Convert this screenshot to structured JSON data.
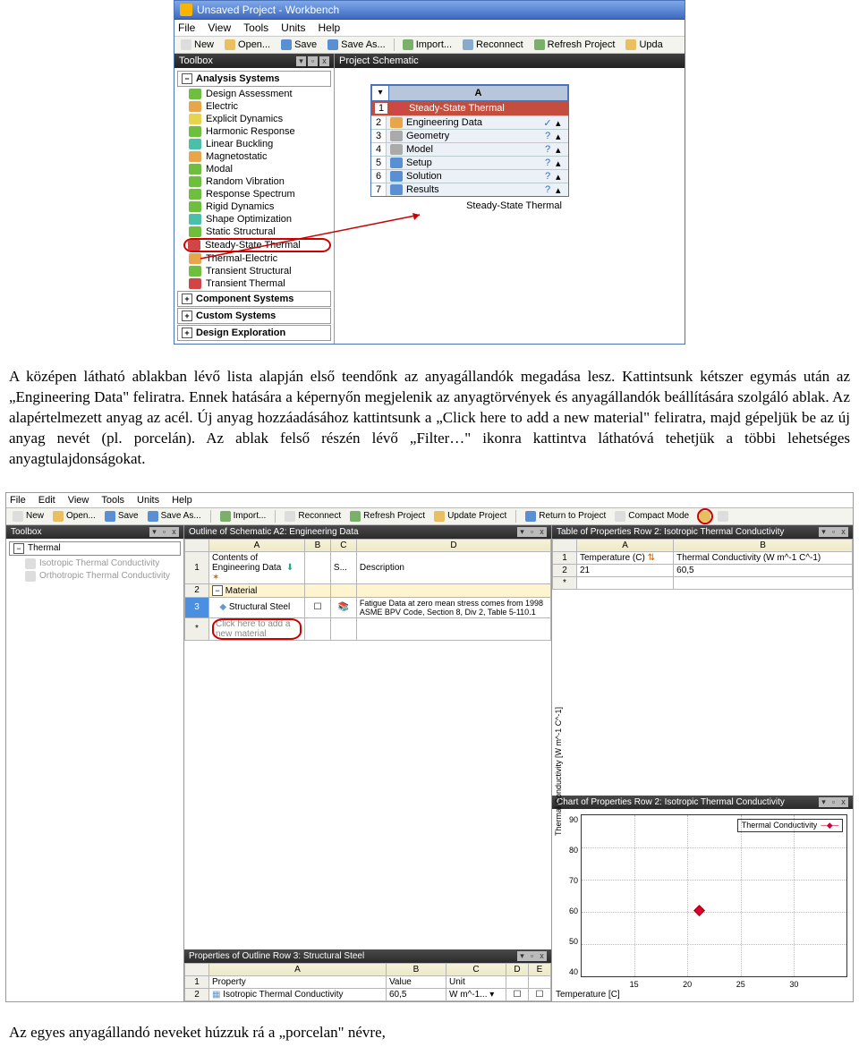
{
  "shot1": {
    "title": "Unsaved Project - Workbench",
    "menu": [
      "File",
      "View",
      "Tools",
      "Units",
      "Help"
    ],
    "toolbar": [
      {
        "icon": "new",
        "label": "New"
      },
      {
        "icon": "open",
        "label": "Open..."
      },
      {
        "icon": "save",
        "label": "Save"
      },
      {
        "icon": "saveas",
        "label": "Save As..."
      },
      {
        "icon": "import",
        "label": "Import..."
      },
      {
        "icon": "reconnect",
        "label": "Reconnect"
      },
      {
        "icon": "refresh",
        "label": "Refresh Project"
      },
      {
        "icon": "upda",
        "label": "Upda"
      }
    ],
    "toolbox_title": "Toolbox",
    "analysis_header": "Analysis Systems",
    "analysis_items": [
      {
        "c": "c-green",
        "t": "Design Assessment"
      },
      {
        "c": "c-orange",
        "t": "Electric"
      },
      {
        "c": "c-yellow",
        "t": "Explicit Dynamics"
      },
      {
        "c": "c-green",
        "t": "Harmonic Response"
      },
      {
        "c": "c-teal",
        "t": "Linear Buckling"
      },
      {
        "c": "c-orange",
        "t": "Magnetostatic"
      },
      {
        "c": "c-green",
        "t": "Modal"
      },
      {
        "c": "c-green",
        "t": "Random Vibration"
      },
      {
        "c": "c-green",
        "t": "Response Spectrum"
      },
      {
        "c": "c-green",
        "t": "Rigid Dynamics"
      },
      {
        "c": "c-teal",
        "t": "Shape Optimization"
      },
      {
        "c": "c-green",
        "t": "Static Structural"
      },
      {
        "c": "c-red",
        "t": "Steady-State Thermal",
        "hl": true
      },
      {
        "c": "c-orange",
        "t": "Thermal-Electric"
      },
      {
        "c": "c-green",
        "t": "Transient Structural"
      },
      {
        "c": "c-red",
        "t": "Transient Thermal"
      }
    ],
    "other_groups": [
      "Component Systems",
      "Custom Systems",
      "Design Exploration"
    ],
    "schematic_title": "Project Schematic",
    "sys": {
      "colA": "A",
      "title": "Steady-State Thermal",
      "rows": [
        {
          "n": "2",
          "ic": "c-orange",
          "t": "Engineering Data",
          "s": "✓"
        },
        {
          "n": "3",
          "ic": "c-gray",
          "t": "Geometry",
          "s": "?"
        },
        {
          "n": "4",
          "ic": "c-gray",
          "t": "Model",
          "s": "?"
        },
        {
          "n": "5",
          "ic": "c-blue",
          "t": "Setup",
          "s": "?"
        },
        {
          "n": "6",
          "ic": "c-blue",
          "t": "Solution",
          "s": "?"
        },
        {
          "n": "7",
          "ic": "c-blue",
          "t": "Results",
          "s": "?"
        }
      ],
      "caption": "Steady-State Thermal"
    }
  },
  "para1": "A középen látható ablakban lévő lista alapján első teendőnk az anyagállandók megadása lesz. Kattintsunk kétszer egymás után az „Engineering Data\" feliratra. Ennek hatására a képernyőn megjelenik az anyagtörvények és anyagállandók beállítására szolgáló ablak. Az alapértelmezett anyag az acél. Új anyag hozzáadásához kattintsunk a „Click here to add a new material\" feliratra, majd gépeljük be az új anyag nevét (pl. porcelán). Az ablak felső részén lévő „Filter…\" ikonra kattintva láthatóvá tehetjük a többi lehetséges anyagtulajdonságokat.",
  "shot2": {
    "menu": [
      "File",
      "Edit",
      "View",
      "Tools",
      "Units",
      "Help"
    ],
    "toolbar": [
      "New",
      "Open...",
      "Save",
      "Save As...",
      "Import...",
      "Reconnect",
      "Refresh Project",
      "Update Project",
      "Return to Project",
      "Compact Mode"
    ],
    "left": {
      "title": "Toolbox",
      "group": "Thermal",
      "items": [
        "Isotropic Thermal Conductivity",
        "Orthotropic Thermal Conductivity"
      ]
    },
    "outline": {
      "title": "Outline of Schematic A2: Engineering Data",
      "cols": [
        "",
        "A",
        "B",
        "C",
        "D"
      ],
      "r1": [
        "1",
        "Contents of Engineering Data",
        "",
        "S...",
        "Description"
      ],
      "r2": [
        "2",
        "Material",
        "",
        "",
        ""
      ],
      "r3": [
        "3",
        "Structural Steel",
        "",
        "",
        "Fatigue Data at zero mean stress comes from 1998 ASME BPV Code, Section 8, Div 2, Table 5-110.1"
      ],
      "r4": [
        "*",
        "Click here to add a new material",
        "",
        "",
        ""
      ]
    },
    "table": {
      "title": "Table of Properties Row 2: Isotropic Thermal Conductivity",
      "cols": [
        "",
        "A",
        "B"
      ],
      "r1": [
        "1",
        "Temperature (C)",
        "Thermal Conductivity (W m^-1 C^-1)"
      ],
      "r2": [
        "2",
        "21",
        "60,5"
      ],
      "r3": [
        "*",
        "",
        ""
      ]
    },
    "props": {
      "title": "Properties of Outline Row 3: Structural Steel",
      "cols": [
        "",
        "A",
        "B",
        "C",
        "D",
        "E"
      ],
      "r1": [
        "1",
        "Property",
        "Value",
        "Unit",
        "",
        ""
      ],
      "r2": [
        "2",
        "Isotropic Thermal Conductivity",
        "60,5",
        "W m^-1...",
        "",
        ""
      ]
    },
    "chart": {
      "title": "Chart of Properties Row 2: Isotropic Thermal Conductivity"
    }
  },
  "chart_data": {
    "type": "scatter",
    "series": [
      {
        "name": "Thermal Conductivity",
        "x": [
          21
        ],
        "y": [
          60.5
        ]
      }
    ],
    "xlabel": "Temperature [C]",
    "ylabel": "Thermal Conductivity [W m^-1 C^-1]",
    "xlim": [
      10,
      35
    ],
    "ylim": [
      40,
      90
    ],
    "xticks": [
      15,
      20,
      25,
      30
    ],
    "yticks": [
      40,
      50,
      60,
      70,
      80,
      90
    ]
  },
  "para2": "Az egyes anyagállandó neveket húzzuk rá a „porcelan\" névre,"
}
